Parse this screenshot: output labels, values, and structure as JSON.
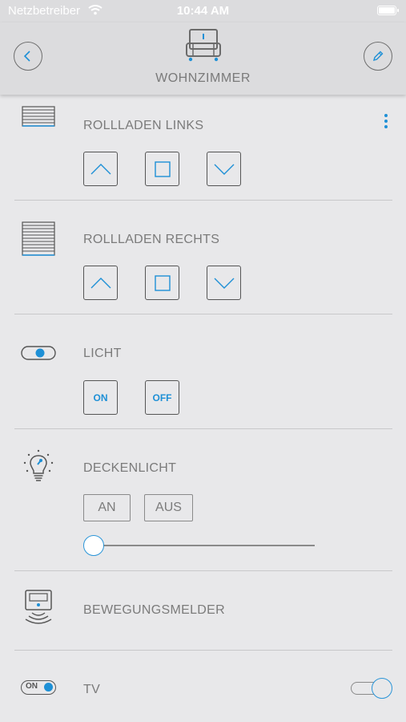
{
  "status_bar": {
    "carrier": "Netzbetreiber",
    "time": "10:44 AM"
  },
  "header": {
    "title": "WOHNZIMMER",
    "back_icon": "chevron-left-icon",
    "edit_icon": "pencil-icon",
    "room_icon": "armchair-icon"
  },
  "colors": {
    "accent": "#1e90d6",
    "background": "#e8e8ea",
    "header": "#dcdcde",
    "text": "#7b7b7b"
  },
  "devices": [
    {
      "name": "ROLLLADEN LINKS",
      "icon": "roller-shutter-icon",
      "controls": [
        "up-arrow",
        "stop",
        "down-arrow"
      ],
      "menu_icon": "more-vertical-icon"
    },
    {
      "name": "ROLLLADEN RECHTS",
      "icon": "roller-shutter-closed-icon",
      "controls": [
        "up-arrow",
        "stop",
        "down-arrow"
      ]
    },
    {
      "name": "LICHT",
      "icon": "switch-icon",
      "on_label": "ON",
      "off_label": "OFF"
    },
    {
      "name": "DECKENLICHT",
      "icon": "light-bulb-icon",
      "on_label": "AN",
      "off_label": "AUS",
      "dimmer_level": 0
    },
    {
      "name": "BEWEGUNGSMELDER",
      "icon": "motion-sensor-icon"
    },
    {
      "name": "TV",
      "icon": "on-switch-icon",
      "icon_label": "ON",
      "toggle_state": "on"
    }
  ]
}
